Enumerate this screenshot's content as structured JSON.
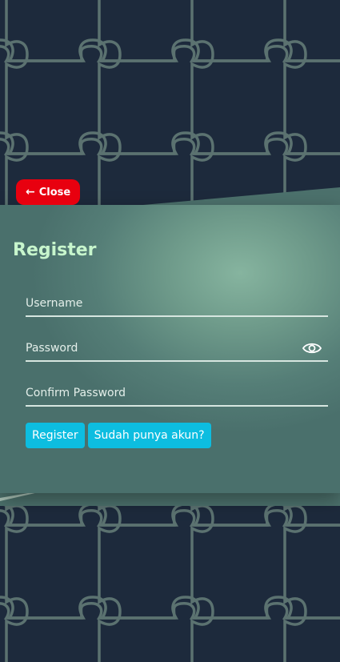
{
  "close_button": {
    "label": "Close",
    "icon": "arrow-left-icon"
  },
  "register_form": {
    "title": "Register",
    "username": {
      "placeholder": "Username",
      "value": ""
    },
    "password": {
      "placeholder": "Password",
      "value": "",
      "toggle_icon": "eye-icon"
    },
    "confirm_password": {
      "placeholder": "Confirm Password",
      "value": ""
    },
    "register_button": "Register",
    "login_button": "Sudah punya akun?"
  },
  "colors": {
    "page_background": "#1d2a3c",
    "puzzle_lines": "#5b7270",
    "close_button": "#e8000f",
    "title": "#c7f5cc",
    "action_button": "#0dbde0"
  }
}
